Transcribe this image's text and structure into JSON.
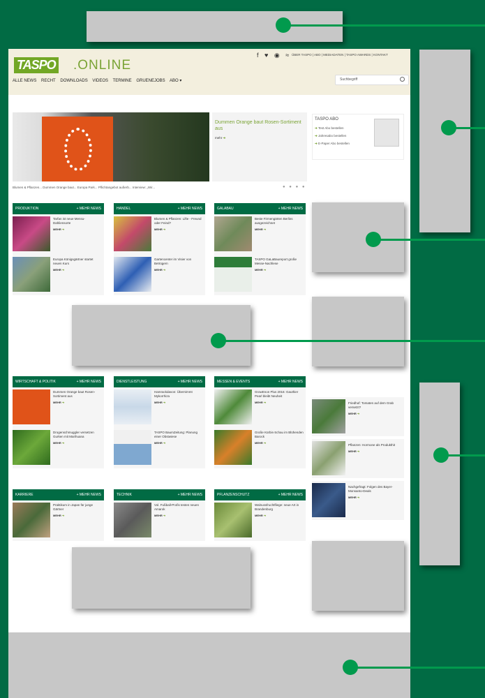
{
  "header": {
    "logo_main": "TASPO",
    "logo_online": ".ONLINE",
    "social_icons": [
      "facebook-icon",
      "twitter-icon",
      "whatsapp-icon",
      "rss-icon"
    ],
    "social_glyphs": "f ♥ ◉ ≈",
    "top_links": "ÜBER TASPO | ABO | MEDIADATEN | TASPO AWARDS | KONTAKT",
    "nav": [
      "ALLE NEWS",
      "RECHT",
      "DOWNLOADS",
      "VIDEOS",
      "TERMINE",
      "GRUENEJOBS",
      "ABO ▾"
    ],
    "search_placeholder": "Suchbegriff"
  },
  "hero": {
    "title": "Dummen Orange baut Rosen-Sortiment aus",
    "more": "mehr",
    "captions": "Blumen & Pflanzen...   Dummen Orange baut...   Europa Park...   Pflichtangebot außerb...   Interview: „Wir...",
    "dots": "● ● ● ●"
  },
  "abo": {
    "title": "TASPO ABO",
    "links": [
      "Test Abo bestellen",
      "Jahresabo bestellen",
      "E-Paper Abo bestellen"
    ]
  },
  "boxes": [
    {
      "title": "PRODUKTION",
      "plus": "+ MEHR NEWS",
      "entries": [
        {
          "text": "Tarfan ist neue Mensu-Dahliensorte",
          "more": "MEHR"
        },
        {
          "text": "Europa Königsgärtner startet neuen Kurs",
          "more": "MEHR"
        }
      ]
    },
    {
      "title": "HANDEL",
      "plus": "+ MEHR NEWS",
      "entries": [
        {
          "text": "Blumen & Pflanzen: Lifte - Freund oder Feind?",
          "more": "MEHR"
        },
        {
          "text": "Gartencenter im Visier von Betrügern",
          "more": "MEHR"
        }
      ]
    },
    {
      "title": "GALABAU",
      "plus": "+ MEHR NEWS",
      "entries": [
        {
          "text": "Beste Firmengärten Berlins ausgezeichnet",
          "more": "MEHR"
        },
        {
          "text": "TASPO GaLaBaureport große Messe-Nachlese",
          "more": "MEHR"
        }
      ]
    },
    {
      "title": "WIRTSCHAFT & POLITIK",
      "plus": "+ MEHR NEWS",
      "entries": [
        {
          "text": "Dummen Orange baut Rosen-Sortiment aus",
          "more": "MEHR"
        },
        {
          "text": "Drogenschmuggler versetzen Gurken mit Marihuana",
          "more": "MEHR"
        }
      ]
    },
    {
      "title": "DIENSTLEISTUNG",
      "plus": "+ MEHR NEWS",
      "entries": [
        {
          "text": "Hamrackdavon: Übernimmt Mykorrhiza",
          "more": "MEHR"
        },
        {
          "text": "TASPO BaumZeitung: Planung einer Obstwiese",
          "more": "MEHR"
        }
      ]
    },
    {
      "title": "MESSEN & EVENTS",
      "plus": "+ MEHR NEWS",
      "entries": [
        {
          "text": "GrowEnon Plus 2016: Gauthier Pearl bleibt Neuheit",
          "more": "MEHR"
        },
        {
          "text": "Große Kürbis-Schau im Blühenden Barock",
          "more": "MEHR"
        }
      ]
    },
    {
      "title": "KARRIERE",
      "plus": "+ MEHR NEWS",
      "entries": [
        {
          "text": "Praktikum in Japan für junge Gärtner",
          "more": "MEHR"
        }
      ]
    },
    {
      "title": "TECHNIK",
      "plus": "+ MEHR NEWS",
      "entries": [
        {
          "text": "Vol. Fußball-Profis testen neuen Amarok",
          "more": "MEHR"
        }
      ]
    },
    {
      "title": "PFLANZENSCHUTZ",
      "plus": "+ MEHR NEWS",
      "entries": [
        {
          "text": "Walnussfruchtfliege: neue Art in Brandenburg",
          "more": "MEHR"
        }
      ]
    }
  ],
  "side_news": [
    {
      "text": "Friedhof: Tomaten auf dem Grab versetzt?",
      "more": "MEHR"
    },
    {
      "text": "Pflanzen: Hormone als Produkthit",
      "more": "MEHR"
    },
    {
      "text": "Nachgefragt: Folgen des Bayer-Monsanto-Deals",
      "more": "MEHR"
    }
  ],
  "colors": {
    "brand_green": "#016b44",
    "accent_green": "#019a4d",
    "logo_green": "#72a725",
    "ad_slot_gray": "#c7c7c7"
  }
}
